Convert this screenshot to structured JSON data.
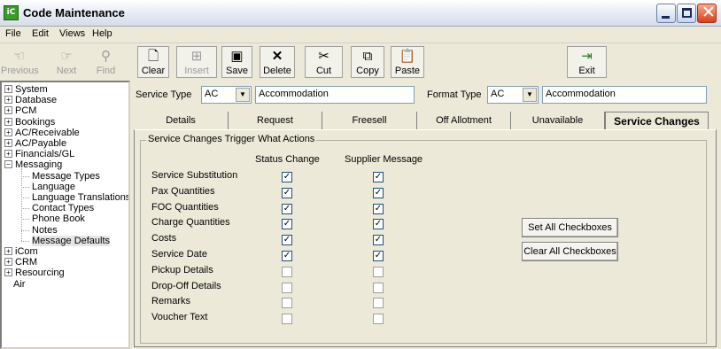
{
  "window": {
    "title": "Code Maintenance",
    "icon": "ic-app-icon"
  },
  "menu": [
    "File",
    "Edit",
    "Views",
    "Help"
  ],
  "toolbar": {
    "previous": "Previous",
    "next": "Next",
    "find": "Find",
    "clear": "Clear",
    "insert": "Insert",
    "save": "Save",
    "delete": "Delete",
    "cut": "Cut",
    "copy": "Copy",
    "paste": "Paste",
    "exit": "Exit"
  },
  "tree": {
    "top": [
      "System",
      "Database",
      "PCM",
      "Bookings",
      "AC/Receivable",
      "AC/Payable",
      "Financials/GL",
      "Messaging"
    ],
    "messaging_children": [
      "Message Types",
      "Language",
      "Language Translations",
      "Contact Types",
      "Phone Book",
      "Notes",
      "Message Defaults"
    ],
    "bottom": [
      "iCom",
      "CRM",
      "Resourcing",
      "Air"
    ],
    "selected": "Message Defaults"
  },
  "service_type": {
    "label": "Service Type",
    "code": "AC",
    "desc": "Accommodation"
  },
  "format_type": {
    "label": "Format Type",
    "code": "AC",
    "desc": "Accommodation"
  },
  "tabs": [
    "Details",
    "Request",
    "Freesell",
    "Off Allotment",
    "Unavailable",
    "Service Changes"
  ],
  "active_tab": "Service Changes",
  "group": {
    "title": "Service Changes Trigger What Actions",
    "col_status": "Status Change",
    "col_supplier": "Supplier Message",
    "rows": [
      {
        "label": "Service Substitution",
        "status": true,
        "supplier": true
      },
      {
        "label": "Pax Quantities",
        "status": true,
        "supplier": true
      },
      {
        "label": "FOC Quantities",
        "status": true,
        "supplier": true
      },
      {
        "label": "Charge Quantities",
        "status": true,
        "supplier": true
      },
      {
        "label": "Costs",
        "status": true,
        "supplier": true
      },
      {
        "label": "Service Date",
        "status": true,
        "supplier": true
      },
      {
        "label": "Pickup Details",
        "status": false,
        "supplier": false
      },
      {
        "label": "Drop-Off Details",
        "status": false,
        "supplier": false
      },
      {
        "label": "Remarks",
        "status": false,
        "supplier": false
      },
      {
        "label": "Voucher Text",
        "status": false,
        "supplier": false
      }
    ],
    "set_all": "Set All Checkboxes",
    "clear_all": "Clear All Checkboxes"
  }
}
